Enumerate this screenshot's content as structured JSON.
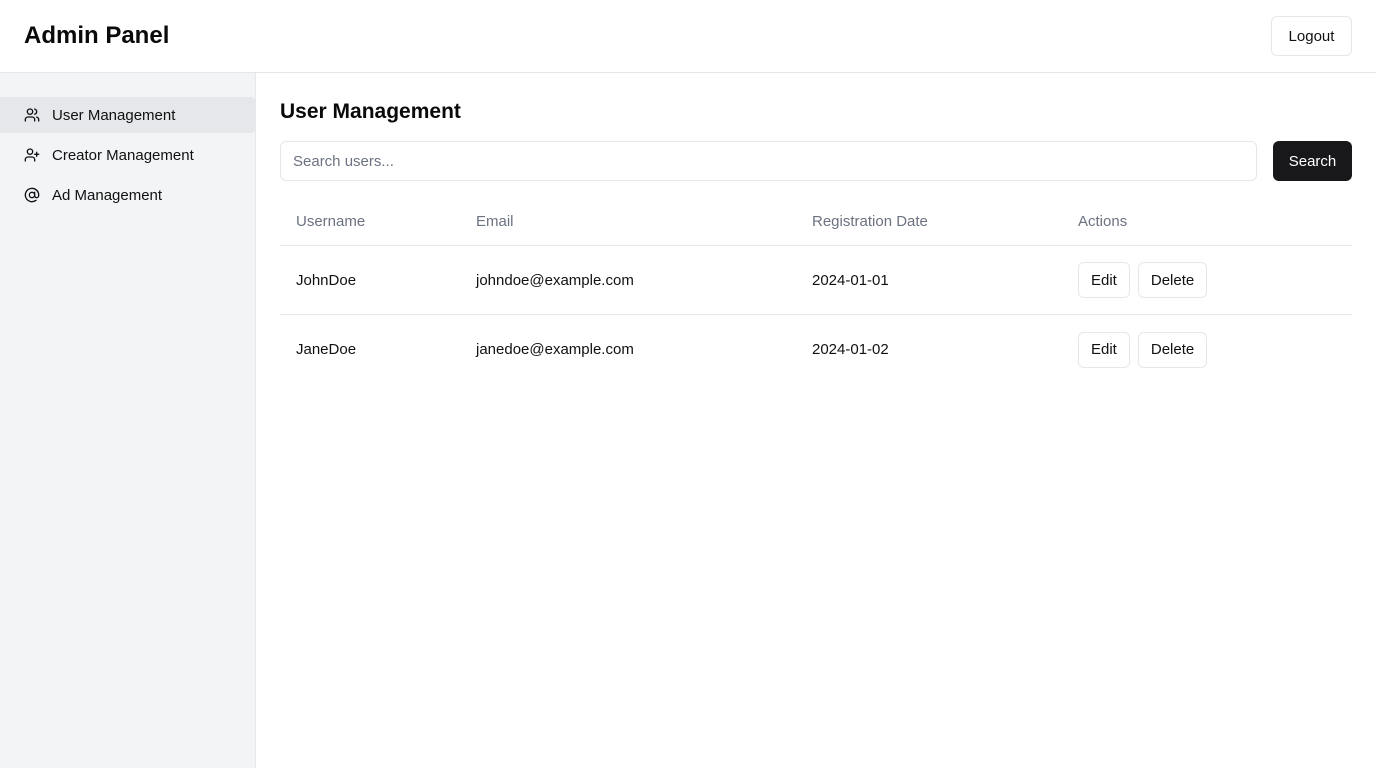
{
  "header": {
    "title": "Admin Panel",
    "logout_label": "Logout"
  },
  "sidebar": {
    "items": [
      {
        "label": "User Management",
        "icon": "users-icon",
        "active": true
      },
      {
        "label": "Creator Management",
        "icon": "user-plus-icon",
        "active": false
      },
      {
        "label": "Ad Management",
        "icon": "at-sign-icon",
        "active": false
      }
    ]
  },
  "main": {
    "title": "User Management",
    "search": {
      "placeholder": "Search users...",
      "value": "",
      "button_label": "Search"
    },
    "table": {
      "columns": [
        "Username",
        "Email",
        "Registration Date",
        "Actions"
      ],
      "rows": [
        {
          "username": "JohnDoe",
          "email": "johndoe@example.com",
          "date": "2024-01-01",
          "edit": "Edit",
          "delete": "Delete"
        },
        {
          "username": "JaneDoe",
          "email": "janedoe@example.com",
          "date": "2024-01-02",
          "edit": "Edit",
          "delete": "Delete"
        }
      ]
    }
  },
  "colors": {
    "primary_button": "#18181b",
    "sidebar_bg": "#f3f4f6",
    "active_item_bg": "#e5e7eb",
    "muted_text": "#6b7280",
    "border": "#e5e7eb"
  }
}
